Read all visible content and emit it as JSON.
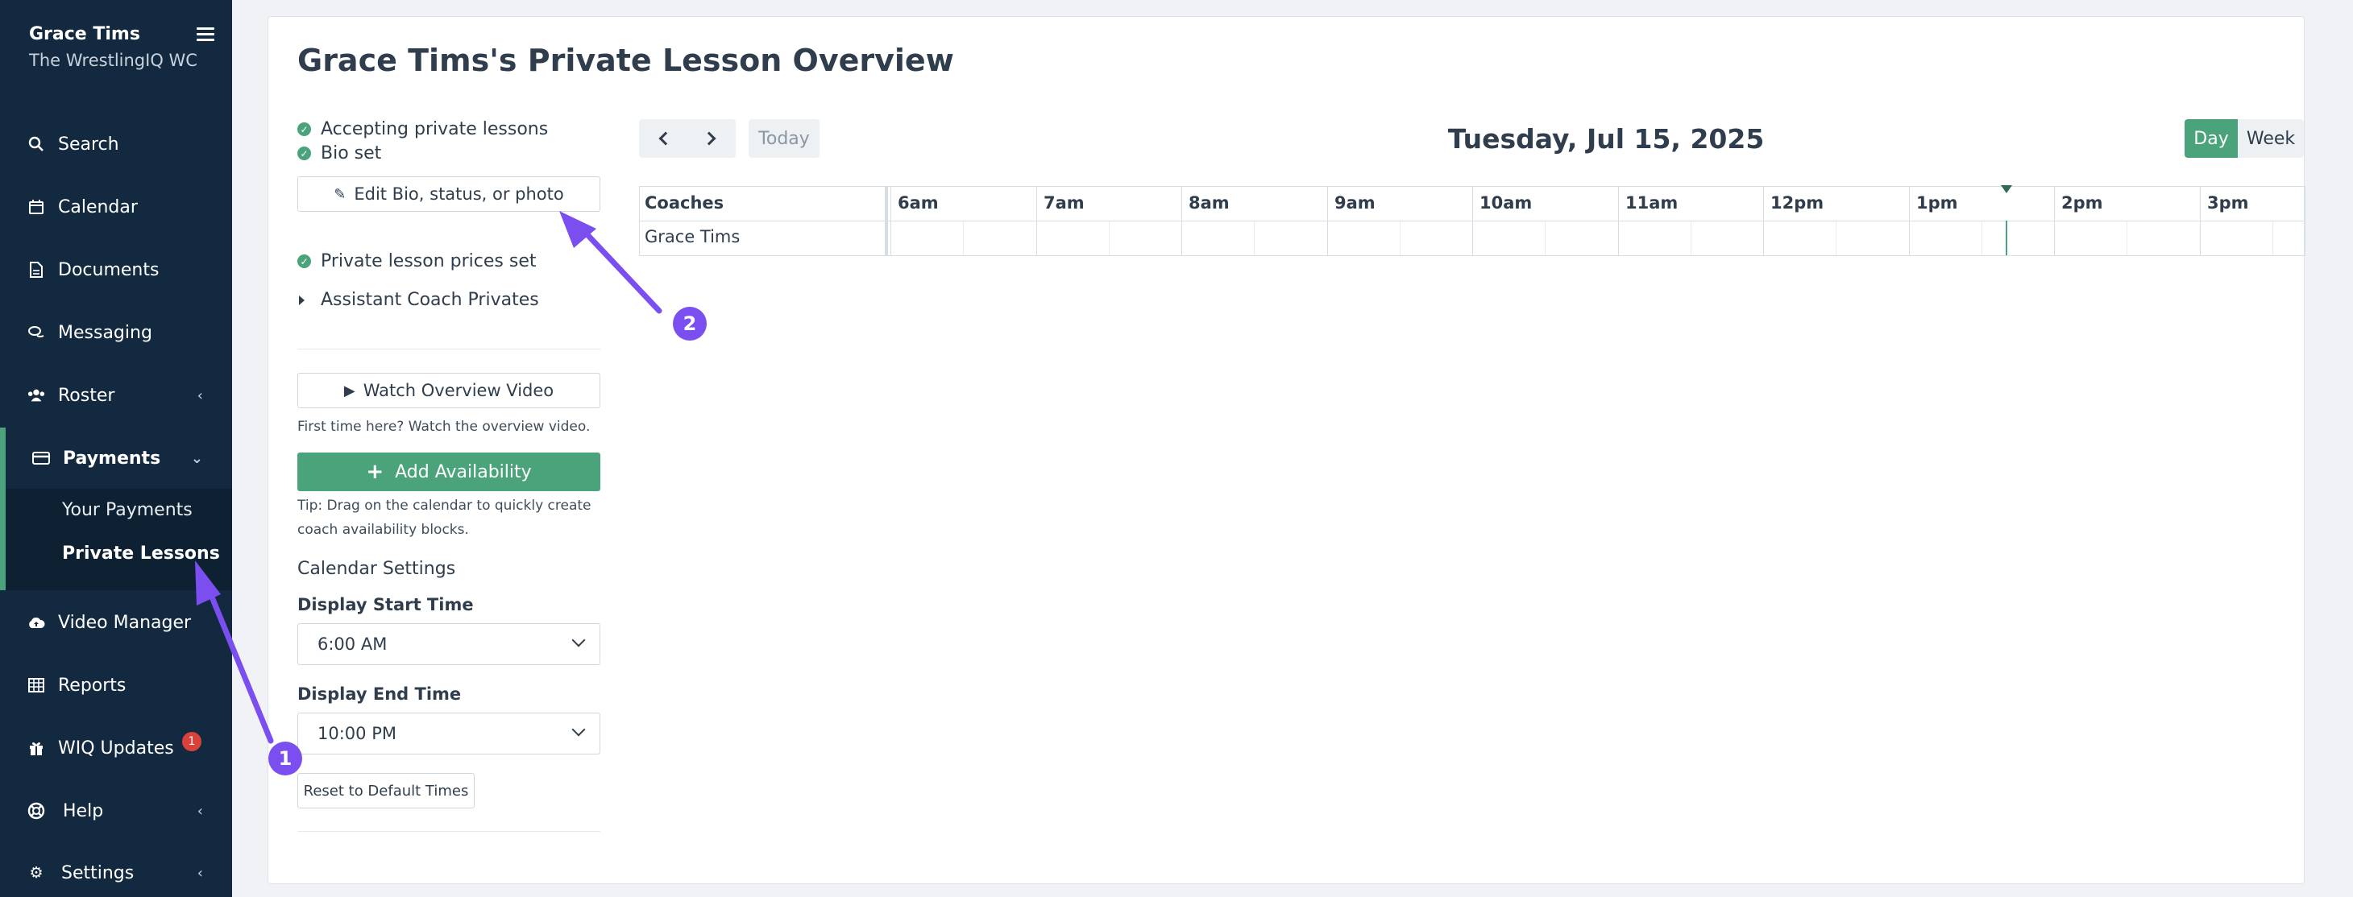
{
  "sidebar": {
    "user_name": "Grace Tims",
    "team_name": "The WrestlingIQ WC",
    "items": [
      {
        "label": "Search",
        "icon": "search-icon"
      },
      {
        "label": "Calendar",
        "icon": "calendar-icon"
      },
      {
        "label": "Documents",
        "icon": "document-icon"
      },
      {
        "label": "Messaging",
        "icon": "chat-icon"
      },
      {
        "label": "Roster",
        "icon": "users-icon"
      },
      {
        "label": "Payments",
        "icon": "credit-card-icon"
      },
      {
        "label": "Video Manager",
        "icon": "cloud-upload-icon"
      },
      {
        "label": "Reports",
        "icon": "table-icon"
      },
      {
        "label": "WIQ Updates",
        "icon": "gift-icon",
        "badge": "1"
      },
      {
        "label": "Help",
        "icon": "life-ring-icon"
      },
      {
        "label": "Settings",
        "icon": "gear-icon"
      }
    ],
    "payments_sub": [
      "Your Payments",
      "Private Lessons"
    ]
  },
  "main": {
    "title": "Grace Tims's Private Lesson Overview",
    "status": {
      "accepting": "Accepting private lessons",
      "bio": "Bio set",
      "edit_button": "Edit Bio, status, or photo",
      "prices": "Private lesson prices set",
      "assistant": "Assistant Coach Privates"
    },
    "video": {
      "button": "Watch Overview Video",
      "hint": "First time here? Watch the overview video."
    },
    "availability": {
      "button": "Add Availability",
      "tip": "Tip: Drag on the calendar to quickly create coach availability blocks."
    },
    "settings": {
      "heading": "Calendar Settings",
      "start_label": "Display Start Time",
      "start_value": "6:00 AM",
      "end_label": "Display End Time",
      "end_value": "10:00 PM",
      "reset": "Reset to Default Times"
    }
  },
  "calendar": {
    "today": "Today",
    "date": "Tuesday, Jul 15, 2025",
    "views": [
      "Day",
      "Week"
    ],
    "active_view": "Day",
    "coaches_header": "Coaches",
    "coaches": [
      "Grace Tims"
    ],
    "hours": [
      "6am",
      "7am",
      "8am",
      "9am",
      "10am",
      "11am",
      "12pm",
      "1pm",
      "2pm",
      "3pm"
    ]
  },
  "annotations": [
    "1",
    "2"
  ],
  "colors": {
    "sidebar": "#13293f",
    "accent": "#4aa37a",
    "annotation": "#7b4ef0",
    "badge": "#d9413b"
  }
}
